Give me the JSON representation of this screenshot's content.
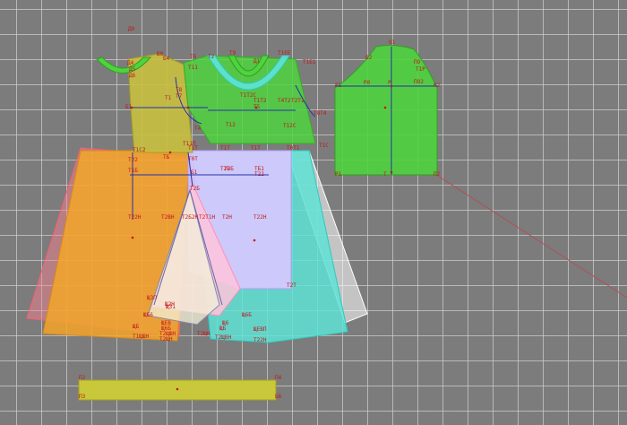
{
  "workspace": {
    "title": "",
    "colors": {
      "background": "#7c7c7c",
      "grid": "#cdcdcd",
      "label": "#c0181c",
      "bodice_front": "#c8c83a",
      "bodice_back": "#4fd33e",
      "skirt_front": "#f0a830",
      "skirt_back": "#5fe3d6",
      "skirt_center": "#c8b8ff",
      "godet": "#ffd0e0",
      "sleeve": "#4fd33e",
      "waistband": "#c8c83a"
    }
  },
  "labels": [
    {
      "text": "Д0"
    },
    {
      "text": "Д4"
    },
    {
      "text": "Д5"
    },
    {
      "text": "Д6"
    },
    {
      "text": "Ш0"
    },
    {
      "text": "Б1"
    },
    {
      "text": "Б4"
    },
    {
      "text": "Т1"
    },
    {
      "text": "Т8"
    },
    {
      "text": "Т7"
    },
    {
      "text": "Т6"
    },
    {
      "text": "Т11"
    },
    {
      "text": "Т12"
    },
    {
      "text": "Т12С"
    },
    {
      "text": "Т5"
    },
    {
      "text": "Т4"
    },
    {
      "text": "Т2"
    },
    {
      "text": "Т9"
    },
    {
      "text": "Т1Т2"
    },
    {
      "text": "Т4Т2"
    },
    {
      "text": "Т2Т1"
    },
    {
      "text": "Т8Т4"
    },
    {
      "text": "Т1Б1"
    },
    {
      "text": "Т1ЕЕ"
    },
    {
      "text": "Т1Т2С"
    },
    {
      "text": "Т11П"
    },
    {
      "text": "Т1С"
    },
    {
      "text": "Д1"
    },
    {
      "text": "О1"
    },
    {
      "text": "О2"
    },
    {
      "text": "ПО"
    },
    {
      "text": "Р0"
    },
    {
      "text": "ПО2"
    },
    {
      "text": "Т1Р"
    },
    {
      "text": "Р1"
    },
    {
      "text": "Р2"
    },
    {
      "text": "Р"
    },
    {
      "text": "Р1"
    },
    {
      "text": "П2"
    },
    {
      "text": "Т"
    },
    {
      "text": "Т1С2"
    },
    {
      "text": "Т1Т"
    },
    {
      "text": "Т1Т"
    },
    {
      "text": "Т1Т"
    },
    {
      "text": "Т0Т1"
    },
    {
      "text": "Т0Т"
    },
    {
      "text": "Т22"
    },
    {
      "text": "ТБ"
    },
    {
      "text": "Т2Б"
    },
    {
      "text": "Т1Б"
    },
    {
      "text": "Б1"
    },
    {
      "text": "ТБ1"
    },
    {
      "text": "Т2Б"
    },
    {
      "text": "Т22"
    },
    {
      "text": "Т22Н"
    },
    {
      "text": "Т2ВН"
    },
    {
      "text": "Т2Б2Н"
    },
    {
      "text": "Т2Т1Н"
    },
    {
      "text": "Т2Н"
    },
    {
      "text": "Т22Н"
    },
    {
      "text": "Т2Б"
    },
    {
      "text": "Т2Т"
    },
    {
      "text": "ЩЗП"
    },
    {
      "text": "Щ2Н"
    },
    {
      "text": "ЩЗ1"
    },
    {
      "text": "ЩБ6"
    },
    {
      "text": "Щ6Б"
    },
    {
      "text": "ЩЕВ"
    },
    {
      "text": "ЩБ"
    },
    {
      "text": "Щ6"
    },
    {
      "text": "ЩЕВП"
    },
    {
      "text": "Щ6Б"
    },
    {
      "text": "ЩБ"
    },
    {
      "text": "Т1ЩШН"
    },
    {
      "text": "Т2ЩШН"
    },
    {
      "text": "Т22Н"
    },
    {
      "text": "Т2ЩН"
    },
    {
      "text": "Т2ЩВН"
    },
    {
      "text": "Т2ЩН"
    },
    {
      "text": "П2"
    },
    {
      "text": "П3"
    },
    {
      "text": "П4"
    },
    {
      "text": "Б6"
    }
  ]
}
